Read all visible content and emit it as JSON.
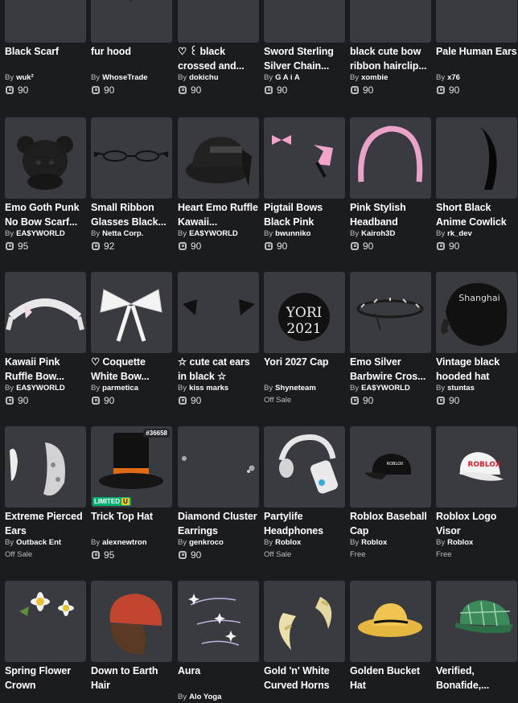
{
  "items": [
    {
      "id": "black-scarf",
      "title": "Black Scarf",
      "creator": "wuk²",
      "price": "90",
      "icon": "scarf-icon"
    },
    {
      "id": "fur-hood",
      "title": "fur hood",
      "creator": "WhoseTrade",
      "price": "90",
      "icon": "fur-hood-icon"
    },
    {
      "id": "black-crossed",
      "title": "♡ ꒰ black crossed and...",
      "creator": "dokichu",
      "price": "90",
      "icon": "crossed-hairclip-icon"
    },
    {
      "id": "sword-chain",
      "title": "Sword Sterling Silver Chain...",
      "creator": "G A i A",
      "price": "90",
      "icon": "sword-chain-icon"
    },
    {
      "id": "bow-hairclip",
      "title": "black cute bow ribbon hairclip...",
      "creator": "xombie",
      "price": "90",
      "icon": "bow-hairclip-icon"
    },
    {
      "id": "pale-ears",
      "title": "Pale Human Ears",
      "creator": "x76",
      "price": "90",
      "icon": "ears-icon"
    },
    {
      "id": "emo-goth-punk",
      "title": "Emo Goth Punk No Bow Scarf...",
      "creator": "EA$YWORLD",
      "price": "95",
      "icon": "bear-scarf-icon"
    },
    {
      "id": "ribbon-glasses",
      "title": "Small Ribbon Glasses Black...",
      "creator": "Netta Corp.",
      "price": "92",
      "icon": "glasses-icon"
    },
    {
      "id": "heart-emo",
      "title": "Heart Emo Ruffle Kawaii...",
      "creator": "EA$YWORLD",
      "price": "90",
      "icon": "cap-ruffle-icon"
    },
    {
      "id": "pigtail-bows",
      "title": "Pigtail Bows Black Pink",
      "creator": "bwunniko",
      "price": "90",
      "icon": "pigtail-bows-icon"
    },
    {
      "id": "pink-headband",
      "title": "Pink Stylish Headband",
      "creator": "Kairoh3D",
      "price": "90",
      "icon": "headband-icon"
    },
    {
      "id": "cowlick",
      "title": "Short Black Anime Cowlick",
      "creator": "rk_dev",
      "price": "90",
      "icon": "cowlick-icon"
    },
    {
      "id": "kawaii-ruffle",
      "title": "Kawaii Pink Ruffle Bow...",
      "creator": "EA$YWORLD",
      "price": "90",
      "icon": "ruffle-headband-icon"
    },
    {
      "id": "coquette-bow",
      "title": "♡ Coquette White Bow...",
      "creator": "parmetica",
      "price": "90",
      "icon": "white-bow-icon"
    },
    {
      "id": "cat-ears",
      "title": "☆ cute cat ears in black ☆",
      "creator": "kiss marks",
      "price": "90",
      "icon": "cat-ears-icon"
    },
    {
      "id": "yori-cap",
      "title": "Yori 2027 Cap",
      "creator": "Shyneteam",
      "price_label": "Off Sale",
      "icon": "yori-cap-icon"
    },
    {
      "id": "barbwire",
      "title": "Emo Silver Barbwire Cros...",
      "creator": "EA$YWORLD",
      "price": "90",
      "icon": "barbwire-icon"
    },
    {
      "id": "vintage-hood",
      "title": "Vintage black hooded hat",
      "creator": "stuntas",
      "price": "90",
      "icon": "hooded-hat-icon"
    },
    {
      "id": "pierced-ears",
      "title": "Extreme Pierced Ears",
      "creator": "Outback Ent",
      "price_label": "Off Sale",
      "icon": "pierced-ears-icon"
    },
    {
      "id": "trick-top-hat",
      "title": "Trick Top Hat",
      "creator": "alexnewtron",
      "price": "95",
      "icon": "top-hat-icon",
      "limited": "LIMITED",
      "limited_u": "U",
      "serial": "#36658"
    },
    {
      "id": "diamond-earrings",
      "title": "Diamond Cluster Earrings",
      "creator": "genkroco",
      "price": "90",
      "icon": "earrings-icon"
    },
    {
      "id": "partylife",
      "title": "Partylife Headphones",
      "creator": "Roblox",
      "price_label": "Off Sale",
      "icon": "headphones-icon"
    },
    {
      "id": "roblox-baseball",
      "title": "Roblox Baseball Cap",
      "creator": "Roblox",
      "price_label": "Free",
      "icon": "baseball-cap-icon"
    },
    {
      "id": "roblox-visor",
      "title": "Roblox Logo Visor",
      "creator": "Roblox",
      "price_label": "Free",
      "icon": "visor-icon"
    },
    {
      "id": "spring-crown",
      "title": "Spring Flower Crown",
      "creator": "",
      "icon": "flower-crown-icon"
    },
    {
      "id": "down-to-earth",
      "title": "Down to Earth Hair",
      "creator": "",
      "icon": "beanie-hair-icon"
    },
    {
      "id": "aura",
      "title": "Aura",
      "creator": "Alo Yoga",
      "icon": "aura-icon"
    },
    {
      "id": "gold-horns",
      "title": "Gold 'n' White Curved Horns",
      "creator": "",
      "icon": "horns-icon"
    },
    {
      "id": "bucket-hat",
      "title": "Golden Bucket Hat",
      "creator": "",
      "icon": "bucket-hat-icon"
    },
    {
      "id": "verified-bonafide",
      "title": "Verified, Bonafide,...",
      "creator": "",
      "icon": "plaid-cap-icon"
    }
  ],
  "labels": {
    "by": "By"
  },
  "colors": {
    "background": "#1b1c20",
    "tile": "#393b41",
    "limited": "#00b06f"
  },
  "thumb_texts": {
    "yori_line1": "YORI",
    "yori_line2": "2021",
    "roblox_cap": "ROBLOX",
    "roblox_visor": "ROBLOX",
    "hood_text": "Shanghai"
  }
}
